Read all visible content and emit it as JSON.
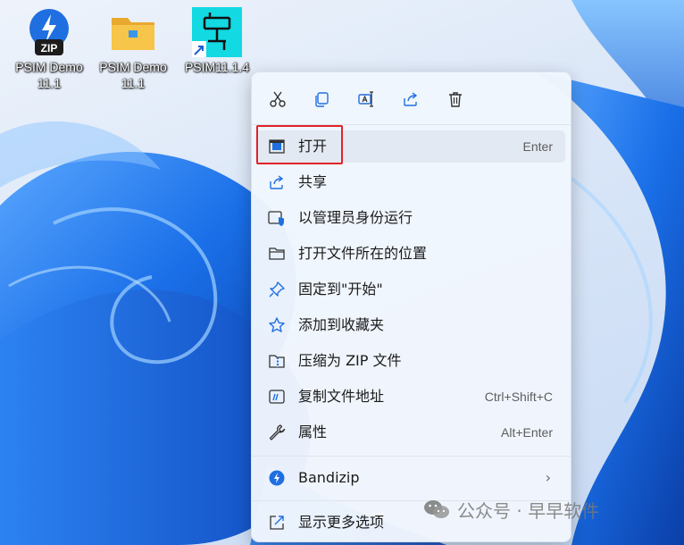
{
  "desktop": {
    "icons": [
      {
        "label": "PSIM Demo\n11.1",
        "icon": "zip-archive-icon"
      },
      {
        "label": "PSIM Demo\n11.1",
        "icon": "folder-icon"
      },
      {
        "label": "PSIM11.1.4",
        "icon": "psim-shortcut-icon"
      }
    ],
    "zip_badge": "ZIP"
  },
  "context_menu": {
    "quick_actions": [
      "cut-icon",
      "copy-icon",
      "rename-icon",
      "share-icon",
      "delete-icon"
    ],
    "items": [
      {
        "label": "打开",
        "shortcut": "Enter",
        "icon": "open-app-icon"
      },
      {
        "label": "共享",
        "shortcut": "",
        "icon": "share-icon"
      },
      {
        "label": "以管理员身份运行",
        "shortcut": "",
        "icon": "shield-admin-icon"
      },
      {
        "label": "打开文件所在的位置",
        "shortcut": "",
        "icon": "folder-icon"
      },
      {
        "label": "固定到\"开始\"",
        "shortcut": "",
        "icon": "pin-icon"
      },
      {
        "label": "添加到收藏夹",
        "shortcut": "",
        "icon": "star-icon"
      },
      {
        "label": "压缩为 ZIP 文件",
        "shortcut": "",
        "icon": "zip-icon"
      },
      {
        "label": "复制文件地址",
        "shortcut": "Ctrl+Shift+C",
        "icon": "copy-path-icon"
      },
      {
        "label": "属性",
        "shortcut": "Alt+Enter",
        "icon": "wrench-icon"
      },
      {
        "label": "Bandizip",
        "shortcut": "",
        "icon": "bandizip-icon",
        "submenu": true
      },
      {
        "label": "显示更多选项",
        "shortcut": "",
        "icon": "more-options-icon"
      }
    ],
    "submenu_chevron": "›"
  },
  "watermark": {
    "text": "公众号 · 早早软件"
  },
  "colors": {
    "highlight_border": "#e0232b",
    "accent": "#1f6fe0",
    "menu_bg": "#f1f6fd"
  }
}
